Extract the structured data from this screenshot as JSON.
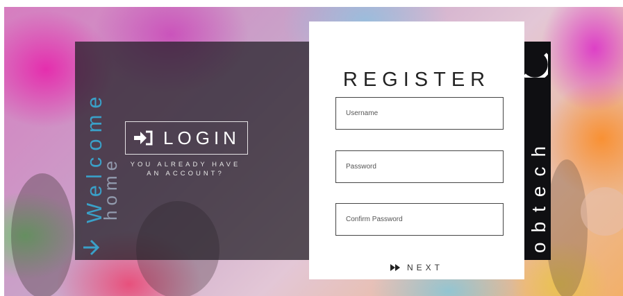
{
  "welcome": {
    "word": "Welcome",
    "sub_word": "home"
  },
  "login": {
    "label": "LOGIN",
    "icon": "sign-in-icon",
    "prompt_line1": "YOU ALREADY HAVE",
    "prompt_line2": "AN ACCOUNT?"
  },
  "register": {
    "title": "REGISTER",
    "fields": [
      {
        "placeholder": "Username"
      },
      {
        "placeholder": "Password"
      },
      {
        "placeholder": "Confirm Password"
      }
    ],
    "next_label": "NEXT",
    "next_icon": "fast-forward-icon"
  },
  "brand": {
    "text": "obtech"
  },
  "colors": {
    "accent": "#3aa0c8",
    "panel": "#1e1c22",
    "card": "#ffffff"
  }
}
